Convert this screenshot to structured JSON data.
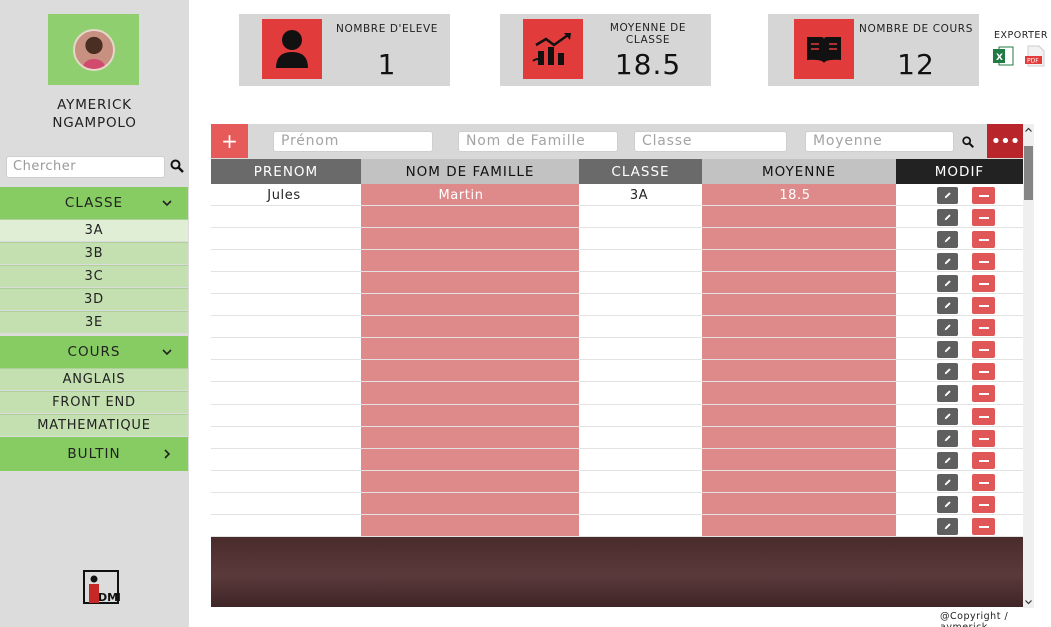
{
  "user": {
    "name_line1": "AYMERICK",
    "name_line2": "NGAMPOLO"
  },
  "sidebar": {
    "search_placeholder": "Chercher",
    "classe_label": "CLASSE",
    "classes": [
      "3A",
      "3B",
      "3C",
      "3D",
      "3E"
    ],
    "cours_label": "COURS",
    "cours": [
      "ANGLAIS",
      "FRONT END",
      "MATHEMATIQUE"
    ],
    "bultin_label": "BULTIN"
  },
  "stats": [
    {
      "label": "NOMBRE D'ELEVE",
      "value": "1",
      "icon": "user-icon"
    },
    {
      "label": "MOYENNE DE CLASSE",
      "value": "18.5",
      "icon": "chart-icon"
    },
    {
      "label": "NOMBRE DE COURS",
      "value": "12",
      "icon": "book-icon"
    }
  ],
  "export": {
    "label": "EXPORTER",
    "excel_icon": "excel-icon",
    "pdf_icon": "pdf-icon",
    "pdf_text": "PDF",
    "excel_text": "X"
  },
  "filters": {
    "prenom": "Prénom",
    "nom": "Nom de Famille",
    "classe": "Classe",
    "moyenne": "Moyenne",
    "add_label": "+",
    "more_label": "•••"
  },
  "table": {
    "headers": {
      "prenom": "PRENOM",
      "nom": "NOM DE FAMILLE",
      "classe": "CLASSE",
      "moyenne": "MOYENNE",
      "modif": "MODIF"
    },
    "rows": [
      {
        "prenom": "Jules",
        "nom": "Martin",
        "classe": "3A",
        "moyenne": "18.5"
      }
    ]
  },
  "footer": {
    "copyright": "@Copyright / aymerick"
  },
  "logo": {
    "text": "DMIN"
  },
  "colors": {
    "accent_red": "#e23b3b",
    "green": "#86cc62",
    "dark_red": "#b8262c",
    "pink_col": "#de8a8a"
  }
}
